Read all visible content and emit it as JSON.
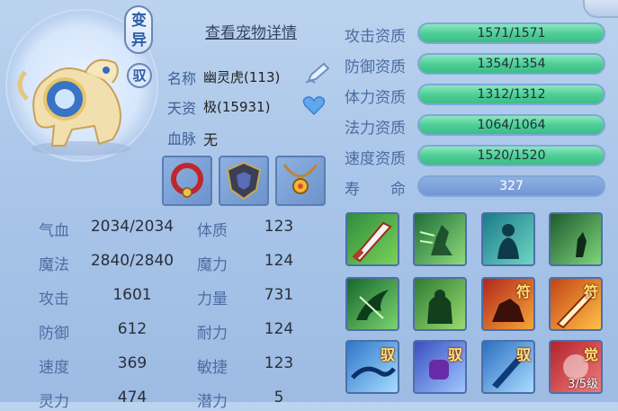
{
  "pet": {
    "mutation_tag": "变异",
    "rider_tag": "驭",
    "details_link": "查看宠物详情",
    "name_label": "名称",
    "name_value": "幽灵虎(113)",
    "talent_label": "天资",
    "talent_value": "极(15931)",
    "bloodline_label": "血脉",
    "bloodline_value": "无"
  },
  "equipment": [
    "collar-icon",
    "armor-icon",
    "necklace-icon"
  ],
  "stats": [
    {
      "label": "气血",
      "value": "2034/2034",
      "label2": "体质",
      "value2": "123"
    },
    {
      "label": "魔法",
      "value": "2840/2840",
      "label2": "魔力",
      "value2": "124"
    },
    {
      "label": "攻击",
      "value": "1601",
      "label2": "力量",
      "value2": "731"
    },
    {
      "label": "防御",
      "value": "612",
      "label2": "耐力",
      "value2": "124"
    },
    {
      "label": "速度",
      "value": "369",
      "label2": "敏捷",
      "value2": "123"
    },
    {
      "label": "灵力",
      "value": "474",
      "label2": "潜力",
      "value2": "5"
    }
  ],
  "aptitudes": [
    {
      "label": "攻击资质",
      "value": "1571/1571",
      "fill": 1.0
    },
    {
      "label": "防御资质",
      "value": "1354/1354",
      "fill": 1.0
    },
    {
      "label": "体力资质",
      "value": "1312/1312",
      "fill": 1.0
    },
    {
      "label": "法力资质",
      "value": "1064/1064",
      "fill": 1.0
    },
    {
      "label": "速度资质",
      "value": "1520/1520",
      "fill": 1.0
    }
  ],
  "lifespan": {
    "label": "寿　　命",
    "value": "327"
  },
  "skills": {
    "badge_fu": "符",
    "badge_yu": "驭",
    "badge_jue": "觉",
    "level_text": "3/5级"
  },
  "colors": {
    "accent": "#3e5f98",
    "bar_green": "#4fcf97",
    "bar_blue": "#7196d3"
  }
}
